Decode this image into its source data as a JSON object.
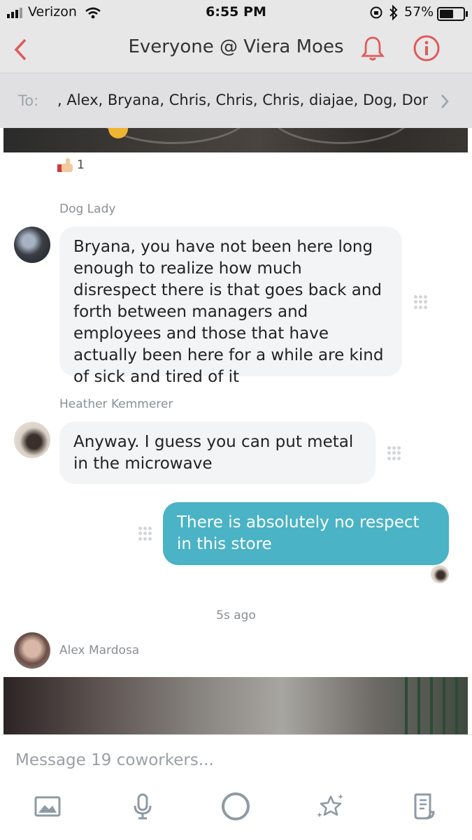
{
  "status": {
    "carrier": "Verizon",
    "time": "6:55 PM",
    "battery": "57%"
  },
  "header": {
    "title": "Everyone @ Viera Moes",
    "to_label": "To:",
    "recipients": ", Alex, Bryana, Chris, Chris, Chris, diajae, Dog, Dont..."
  },
  "messages": [
    {
      "type": "reaction",
      "emoji": "thumbs-up",
      "count": "1"
    },
    {
      "type": "incoming",
      "sender": "Dog Lady",
      "text": "Bryana, you have not been here long enough to realize how much disrespect there is that goes back and forth between managers and employees and those that have actually been here for a while are kind of sick and tired of it"
    },
    {
      "type": "incoming",
      "sender": "Heather Kemmerer",
      "text": "Anyway. I guess you can put metal in the microwave"
    },
    {
      "type": "outgoing",
      "text": "There is absolutely no respect in this store"
    },
    {
      "type": "timestamp",
      "text": "5s ago"
    },
    {
      "type": "incoming-image",
      "sender": "Alex Mardosa"
    }
  ],
  "composer": {
    "placeholder": "Message 19 coworkers..."
  },
  "toolbar": {
    "icons": [
      "image-icon",
      "microphone-icon",
      "circle-icon",
      "stars-icon",
      "notes-icon"
    ]
  },
  "colors": {
    "accent_red": "#e05a5a",
    "outgoing_bubble": "#4ab3c6",
    "incoming_bubble": "#f2f4f6",
    "icon_gray": "#8e9aa4"
  }
}
